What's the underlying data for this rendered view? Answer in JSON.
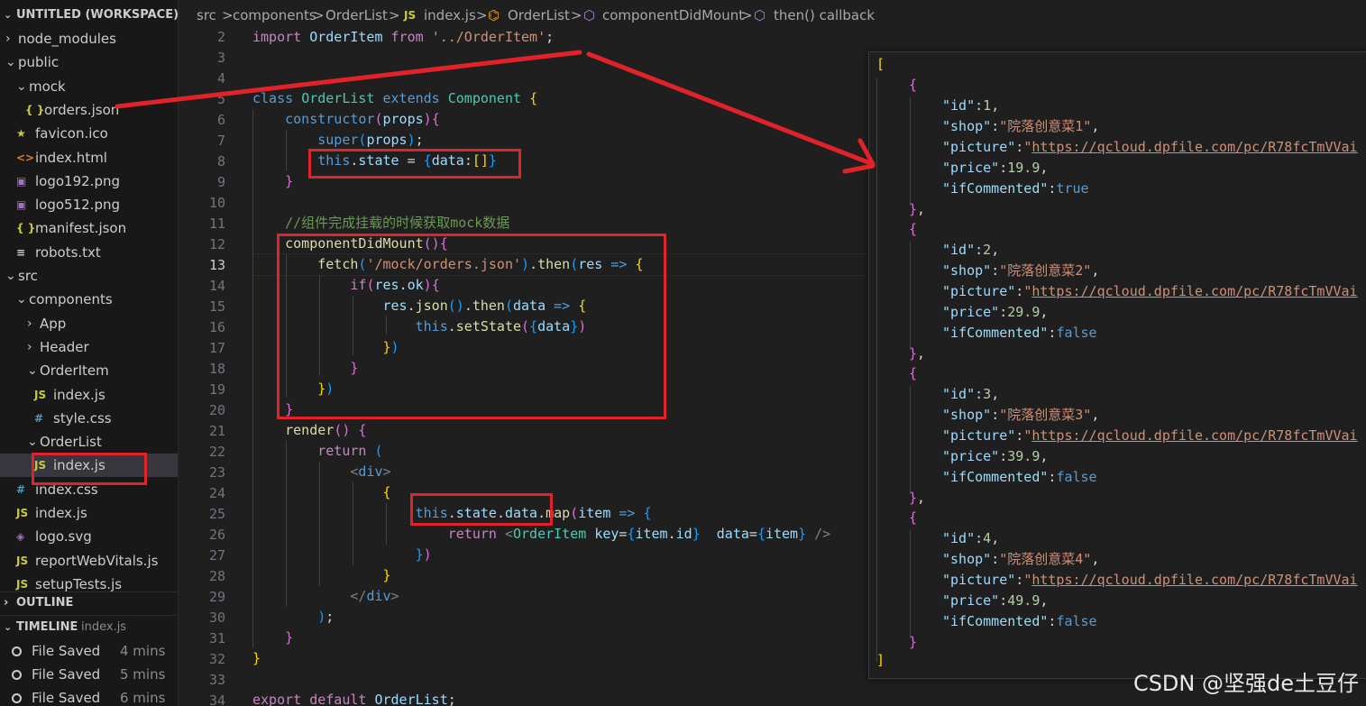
{
  "explorer": {
    "workspace_title": "UNTITLED (WORKSPACE)",
    "items": [
      {
        "label": "node_modules",
        "kind": "folder",
        "open": false,
        "icon": ""
      },
      {
        "label": "public",
        "kind": "folder",
        "open": true,
        "icon": ""
      },
      {
        "label": "mock",
        "kind": "folder",
        "open": true,
        "icon": ""
      },
      {
        "label": "orders.json",
        "kind": "file",
        "icon": "{ }"
      },
      {
        "label": "favicon.ico",
        "kind": "file",
        "icon": "★"
      },
      {
        "label": "index.html",
        "kind": "file",
        "icon": "<>"
      },
      {
        "label": "logo192.png",
        "kind": "file",
        "icon": "▣"
      },
      {
        "label": "logo512.png",
        "kind": "file",
        "icon": "▣"
      },
      {
        "label": "manifest.json",
        "kind": "file",
        "icon": "{ }"
      },
      {
        "label": "robots.txt",
        "kind": "file",
        "icon": "≡"
      },
      {
        "label": "src",
        "kind": "folder",
        "open": true,
        "icon": ""
      },
      {
        "label": "components",
        "kind": "folder",
        "open": true,
        "icon": ""
      },
      {
        "label": "App",
        "kind": "folder",
        "open": false,
        "icon": ""
      },
      {
        "label": "Header",
        "kind": "folder",
        "open": false,
        "icon": ""
      },
      {
        "label": "OrderItem",
        "kind": "folder",
        "open": true,
        "icon": ""
      },
      {
        "label": "index.js",
        "kind": "file",
        "icon": "JS"
      },
      {
        "label": "style.css",
        "kind": "file",
        "icon": "#"
      },
      {
        "label": "OrderList",
        "kind": "folder",
        "open": true,
        "icon": ""
      },
      {
        "label": "index.js",
        "kind": "file",
        "icon": "JS"
      },
      {
        "label": "index.css",
        "kind": "file",
        "icon": "#"
      },
      {
        "label": "index.js",
        "kind": "file",
        "icon": "JS"
      },
      {
        "label": "logo.svg",
        "kind": "file",
        "icon": "◈"
      },
      {
        "label": "reportWebVitals.js",
        "kind": "file",
        "icon": "JS"
      },
      {
        "label": "setupTests.js",
        "kind": "file",
        "icon": "JS"
      }
    ],
    "outline_title": "OUTLINE",
    "timeline_title": "TIMELINE",
    "timeline_file": "index.js",
    "timeline": [
      {
        "label": "File Saved",
        "time": "4 mins"
      },
      {
        "label": "File Saved",
        "time": "5 mins"
      },
      {
        "label": "File Saved",
        "time": "6 mins"
      }
    ]
  },
  "breadcrumb": {
    "parts": [
      "src",
      "components",
      "OrderList",
      "index.js",
      "OrderList",
      "componentDidMount",
      "then() callback"
    ],
    "sep": ">"
  },
  "editor": {
    "line_numbers": [
      "2",
      "3",
      "4",
      "5",
      "6",
      "7",
      "8",
      "9",
      "10",
      "11",
      "12",
      "13",
      "14",
      "15",
      "16",
      "17",
      "18",
      "19",
      "20",
      "21",
      "22",
      "23",
      "24",
      "25",
      "26",
      "27",
      "28",
      "29",
      "30",
      "31",
      "32",
      "33",
      "34"
    ],
    "current_line": "13",
    "comment_line": "//组件完成挂载的时候获取mock数据"
  },
  "json_panel": {
    "orders": [
      {
        "id": "1",
        "shop": "院落创意菜1",
        "picture": "https://qcloud.dpfile.com/pc/R78fcTmVVai",
        "price": "19.9",
        "ifCommented": "true"
      },
      {
        "id": "2",
        "shop": "院落创意菜2",
        "picture": "https://qcloud.dpfile.com/pc/R78fcTmVVai",
        "price": "29.9",
        "ifCommented": "false"
      },
      {
        "id": "3",
        "shop": "院落创意菜3",
        "picture": "https://qcloud.dpfile.com/pc/R78fcTmVVai",
        "price": "39.9",
        "ifCommented": "false"
      },
      {
        "id": "4",
        "shop": "院落创意菜4",
        "picture": "https://qcloud.dpfile.com/pc/R78fcTmVVai",
        "price": "49.9",
        "ifCommented": "false"
      }
    ]
  },
  "watermark": "CSDN @坚强de土豆仔",
  "colors": {
    "annotation_red": "#e0222a",
    "editor_bg": "#1f1f1f",
    "sidebar_bg": "#181818",
    "selection": "#37373d"
  }
}
